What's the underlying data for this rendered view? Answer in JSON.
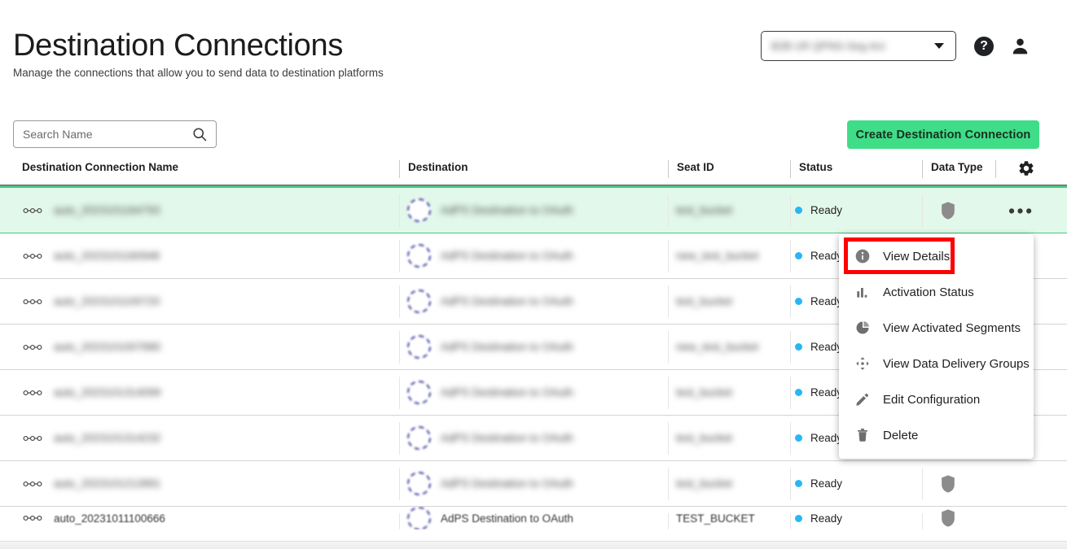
{
  "header": {
    "title": "Destination Connections",
    "subtitle": "Manage the connections that allow you to send data to destination platforms",
    "account_select_value": "B2B UR QPNG-Seg-Act",
    "help_icon": "help-circle-icon",
    "user_icon": "person-icon",
    "caret_icon": "chevron-down-icon"
  },
  "toolbar": {
    "search_placeholder": "Search Name",
    "search_value": "",
    "search_icon": "search-icon",
    "create_button_label": "Create Destination Connection",
    "create_button_color": "#3fdd87"
  },
  "table": {
    "columns": [
      "Destination Connection Name",
      "Destination",
      "Seat ID",
      "Status",
      "Data Type"
    ],
    "settings_icon": "gear-icon",
    "accent_color": "#4cc583",
    "selected_row_color": "#e2f8ea",
    "status_dot_color": "#29b6f6",
    "rows": [
      {
        "name": "auto_2023101164793",
        "destination": "AdPS Destination to OAuth",
        "seat_id": "test_bucket",
        "status": "Ready",
        "data_type": "shield-icon",
        "menu_icon": "ellipsis-icon",
        "selected": true
      },
      {
        "name": "auto_2023101160946",
        "destination": "AdPS Destination to OAuth",
        "seat_id": "new_test_bucket",
        "status": "Ready",
        "data_type": "",
        "menu_icon": "",
        "selected": false
      },
      {
        "name": "auto_2023101100720",
        "destination": "AdPS Destination to OAuth",
        "seat_id": "test_bucket",
        "status": "Ready",
        "data_type": "",
        "menu_icon": "",
        "selected": false
      },
      {
        "name": "auto_2023101007680",
        "destination": "AdPS Destination to OAuth",
        "seat_id": "new_test_bucket",
        "status": "Ready",
        "data_type": "",
        "menu_icon": "",
        "selected": false
      },
      {
        "name": "auto_2023101314099",
        "destination": "AdPS Destination to OAuth",
        "seat_id": "test_bucket",
        "status": "Ready",
        "data_type": "",
        "menu_icon": "",
        "selected": false
      },
      {
        "name": "auto_2023101314232",
        "destination": "AdPS Destination to OAuth",
        "seat_id": "test_bucket",
        "status": "Ready",
        "data_type": "",
        "menu_icon": "",
        "selected": false
      },
      {
        "name": "auto_2023101212891",
        "destination": "AdPS Destination to OAuth",
        "seat_id": "test_bucket",
        "status": "Ready",
        "data_type": "shield-icon",
        "menu_icon": "",
        "selected": false
      },
      {
        "name": "auto_20231011100666",
        "destination": "AdPS Destination to OAuth",
        "seat_id": "TEST_BUCKET",
        "status": "Ready",
        "data_type": "shield-icon",
        "menu_icon": "",
        "selected": false
      }
    ]
  },
  "context_menu": {
    "highlighted_item": "View Details",
    "highlight_color": "#ff0000",
    "items": [
      {
        "label": "View Details",
        "icon": "info-circle-icon"
      },
      {
        "label": "Activation Status",
        "icon": "bar-chart-icon"
      },
      {
        "label": "View Activated Segments",
        "icon": "pie-chart-icon"
      },
      {
        "label": "View Data Delivery Groups",
        "icon": "move-arrows-icon"
      },
      {
        "label": "Edit Configuration",
        "icon": "pencil-icon"
      },
      {
        "label": "Delete",
        "icon": "trash-icon"
      }
    ]
  }
}
